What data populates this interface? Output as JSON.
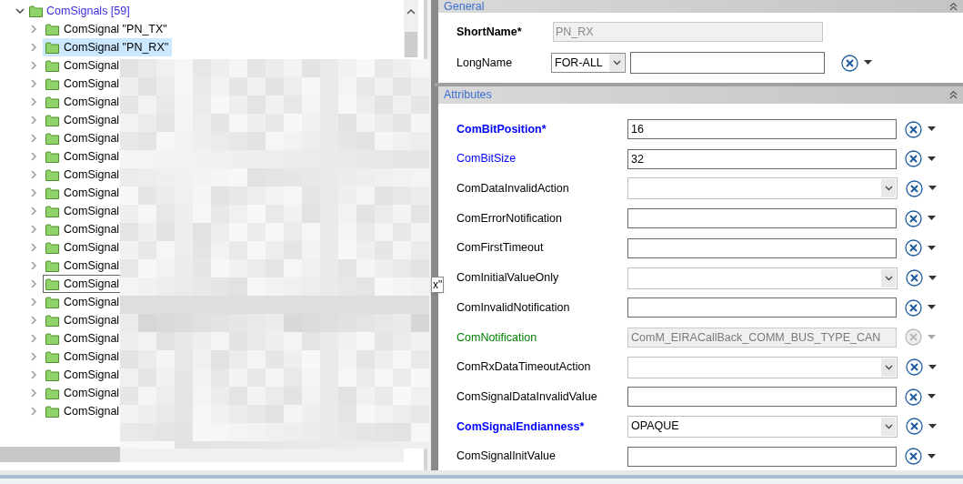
{
  "tree": {
    "label": "ComSignals [59]",
    "expanded": true,
    "children": [
      {
        "label": "ComSignal \"PN_TX\"",
        "expanded": false,
        "selected": false,
        "focused": false
      },
      {
        "label": "ComSignal \"PN_RX\"",
        "expanded": false,
        "selected": true,
        "focused": false
      },
      {
        "label": "ComSignal",
        "expanded": false,
        "selected": false,
        "focused": false
      },
      {
        "label": "ComSignal",
        "expanded": false,
        "selected": false,
        "focused": false
      },
      {
        "label": "ComSignal",
        "expanded": false,
        "selected": false,
        "focused": false
      },
      {
        "label": "ComSignal",
        "expanded": false,
        "selected": false,
        "focused": false
      },
      {
        "label": "ComSignal",
        "expanded": false,
        "selected": false,
        "focused": false
      },
      {
        "label": "ComSignal",
        "expanded": false,
        "selected": false,
        "focused": false
      },
      {
        "label": "ComSignal",
        "expanded": false,
        "selected": false,
        "focused": false
      },
      {
        "label": "ComSignal",
        "expanded": false,
        "selected": false,
        "focused": false
      },
      {
        "label": "ComSignal",
        "expanded": false,
        "selected": false,
        "focused": false
      },
      {
        "label": "ComSignal",
        "expanded": false,
        "selected": false,
        "focused": false
      },
      {
        "label": "ComSignal",
        "expanded": false,
        "selected": false,
        "focused": false
      },
      {
        "label": "ComSignal",
        "expanded": false,
        "selected": false,
        "focused": false
      },
      {
        "label": "ComSignal",
        "expanded": false,
        "selected": false,
        "focused": true
      },
      {
        "label": "ComSignal",
        "expanded": false,
        "selected": false,
        "focused": false
      },
      {
        "label": "ComSignal",
        "expanded": false,
        "selected": false,
        "focused": false
      },
      {
        "label": "ComSignal",
        "expanded": false,
        "selected": false,
        "focused": false
      },
      {
        "label": "ComSignal",
        "expanded": false,
        "selected": false,
        "focused": false
      },
      {
        "label": "ComSignal",
        "expanded": false,
        "selected": false,
        "focused": false
      },
      {
        "label": "ComSignal",
        "expanded": false,
        "selected": false,
        "focused": false
      },
      {
        "label": "ComSignal",
        "expanded": false,
        "selected": false,
        "focused": false
      }
    ]
  },
  "splitter_tooltip": "x\"",
  "general": {
    "title": "General",
    "short_name": {
      "label": "ShortName*",
      "value": "PN_RX",
      "disabled": true
    },
    "long_name": {
      "label": "LongName",
      "language": "FOR-ALL"
    }
  },
  "attributes": {
    "title": "Attributes",
    "rows": [
      {
        "label": "ComBitPosition*",
        "color": "#0000ff",
        "bold": true,
        "kind": "text",
        "value": "16",
        "disabled": false
      },
      {
        "label": "ComBitSize",
        "color": "#0000ff",
        "bold": false,
        "kind": "text",
        "value": "32",
        "disabled": false
      },
      {
        "label": "ComDataInvalidAction",
        "color": "#000000",
        "bold": false,
        "kind": "combo",
        "disabled": false
      },
      {
        "label": "ComErrorNotification",
        "color": "#000000",
        "bold": false,
        "kind": "text",
        "disabled": false
      },
      {
        "label": "ComFirstTimeout",
        "color": "#000000",
        "bold": false,
        "kind": "text",
        "disabled": false
      },
      {
        "label": "ComInitialValueOnly",
        "color": "#000000",
        "bold": false,
        "kind": "combo",
        "disabled": false
      },
      {
        "label": "ComInvalidNotification",
        "color": "#000000",
        "bold": false,
        "kind": "text",
        "disabled": false
      },
      {
        "label": "ComNotification",
        "color": "#008000",
        "bold": false,
        "kind": "text",
        "value": "ComM_EIRACallBack_COMM_BUS_TYPE_CAN",
        "disabled": true
      },
      {
        "label": "ComRxDataTimeoutAction",
        "color": "#000000",
        "bold": false,
        "kind": "combo",
        "disabled": false
      },
      {
        "label": "ComSignalDataInvalidValue",
        "color": "#000000",
        "bold": false,
        "kind": "text",
        "disabled": false
      },
      {
        "label": "ComSignalEndianness*",
        "color": "#0000ff",
        "bold": true,
        "kind": "combo",
        "value": "OPAQUE",
        "disabled": false
      },
      {
        "label": "ComSignalInitValue",
        "color": "#000000",
        "bold": false,
        "kind": "text",
        "disabled": false
      }
    ]
  }
}
